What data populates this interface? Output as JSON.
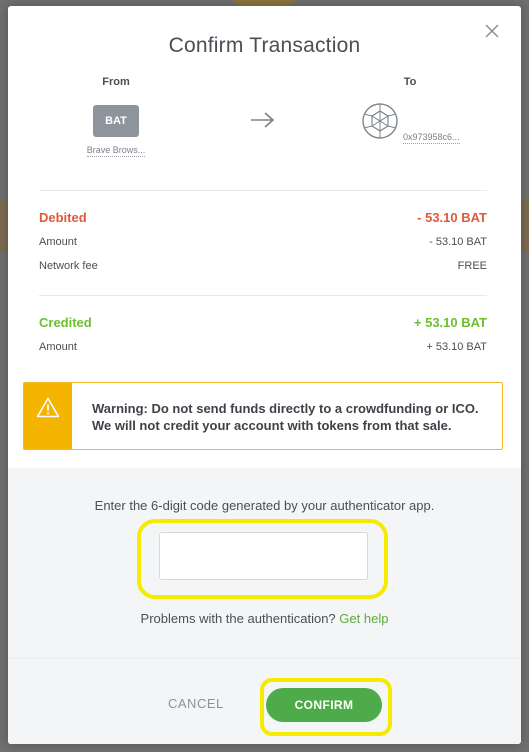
{
  "modal": {
    "title": "Confirm Transaction"
  },
  "from": {
    "label": "From",
    "badge": "BAT",
    "name": "Brave Brows..."
  },
  "to": {
    "label": "To",
    "address": "0x973958c6..."
  },
  "debited": {
    "label": "Debited",
    "total": "- 53.10 BAT",
    "amount_label": "Amount",
    "amount_value": "- 53.10 BAT",
    "fee_label": "Network fee",
    "fee_value": "FREE"
  },
  "credited": {
    "label": "Credited",
    "total": "+ 53.10 BAT",
    "amount_label": "Amount",
    "amount_value": "+ 53.10 BAT"
  },
  "warning": {
    "line1": "Warning: Do not send funds directly to a crowdfunding or ICO.",
    "line2": "We will not credit your account with tokens from that sale."
  },
  "auth": {
    "instruction": "Enter the 6-digit code generated by your authenticator app.",
    "code_value": "",
    "problems_text": "Problems with the authentication?",
    "help_link": "Get help"
  },
  "actions": {
    "cancel_label": "CANCEL",
    "confirm_label": "CONFIRM"
  },
  "colors": {
    "debit": "#e05a3a",
    "credit": "#6cbf2d",
    "confirm": "#4eab4a",
    "warning": "#f5b400",
    "highlight": "#f5ea00"
  }
}
